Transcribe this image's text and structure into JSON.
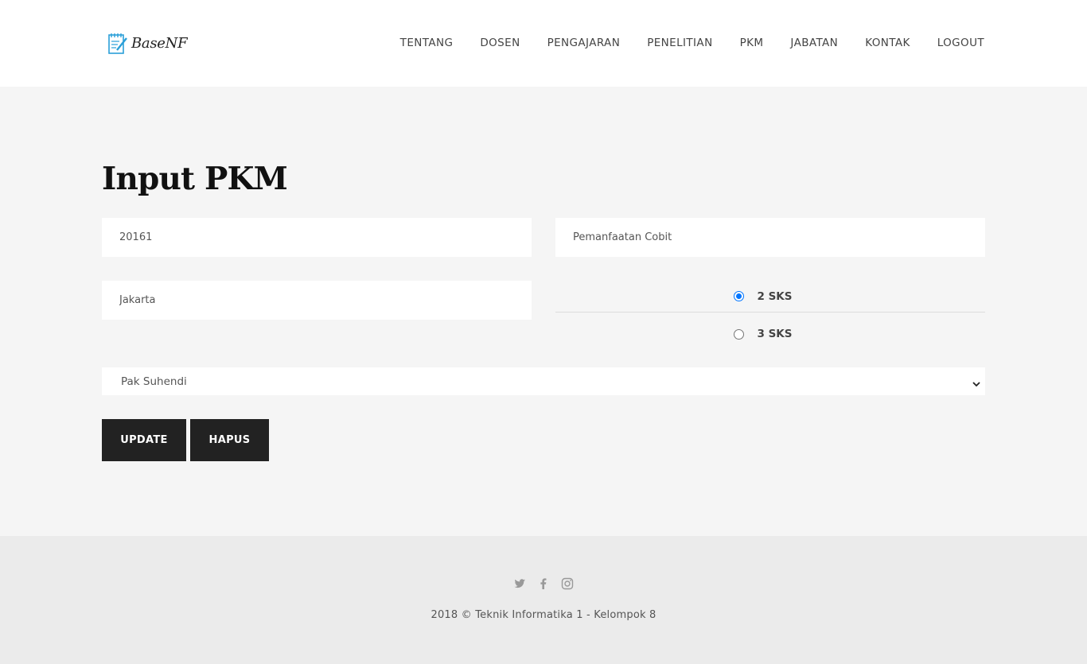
{
  "brand": {
    "name": "BaseNF",
    "icon": "notepad-pencil-icon"
  },
  "nav": {
    "items": [
      {
        "label": "TENTANG"
      },
      {
        "label": "DOSEN"
      },
      {
        "label": "PENGAJARAN"
      },
      {
        "label": "PENELITIAN"
      },
      {
        "label": "PKM"
      },
      {
        "label": "JABATAN"
      },
      {
        "label": "KONTAK"
      },
      {
        "label": "LOGOUT"
      }
    ]
  },
  "form": {
    "title": "Input PKM",
    "kode": "20161",
    "judul": "Pemanfaatan Cobit",
    "tempat": "Jakarta",
    "sks_options": [
      {
        "label": "2 SKS",
        "checked": true
      },
      {
        "label": "3 SKS",
        "checked": false
      }
    ],
    "dosen_selected": "Pak Suhendi",
    "update_label": "UPDATE",
    "hapus_label": "HAPUS"
  },
  "footer": {
    "social": [
      "twitter-icon",
      "facebook-icon",
      "instagram-icon"
    ],
    "copyright": "2018 © Teknik Informatika 1 - Kelompok 8"
  },
  "colors": {
    "accent": "#0075ff",
    "button": "#222222",
    "footer_bg": "#ebebeb",
    "main_bg": "#f5f5f5"
  }
}
